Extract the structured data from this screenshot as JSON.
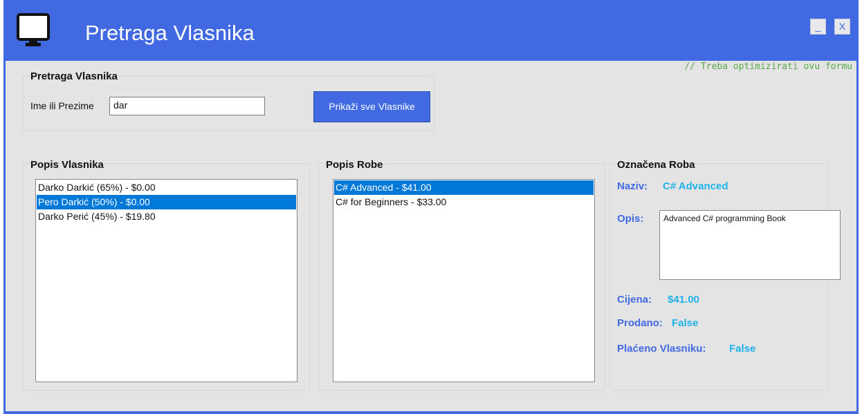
{
  "window": {
    "title": "Pretraga Vlasnika",
    "minimize_label": "_",
    "close_label": "X",
    "app_icon": "monitor-icon",
    "colors": {
      "title_bar": "#4169e1",
      "client_bg": "#e4e4e4",
      "accent": "#1fb2e8",
      "selection": "#0078d7"
    }
  },
  "comment": "// Treba optimizirati ovu formu",
  "search": {
    "group_title": "Pretraga Vlasnika",
    "label": "Ime ili Prezime",
    "value": "dar",
    "show_all_button": "Prikaži sve Vlasnike"
  },
  "owners": {
    "title": "Popis Vlasnika",
    "items": [
      {
        "text": "Darko Darkić (65%) - $0.00",
        "selected": false
      },
      {
        "text": "Pero Darkić (50%) - $0.00",
        "selected": true
      },
      {
        "text": "Darko Perić (45%) - $19.80",
        "selected": false
      }
    ]
  },
  "goods": {
    "title": "Popis Robe",
    "items": [
      {
        "text": "C# Advanced - $41.00",
        "selected": true
      },
      {
        "text": "C# for Beginners - $33.00",
        "selected": false
      }
    ]
  },
  "selected_goods": {
    "title": "Označena Roba",
    "name_label": "Naziv:",
    "name_value": "C# Advanced",
    "description_label": "Opis:",
    "description_value": "Advanced C# programming Book",
    "price_label": "Cijena:",
    "price_value": "$41.00",
    "sold_label": "Prodano:",
    "sold_value": "False",
    "paid_label": "Plaćeno Vlasniku:",
    "paid_value": "False"
  }
}
